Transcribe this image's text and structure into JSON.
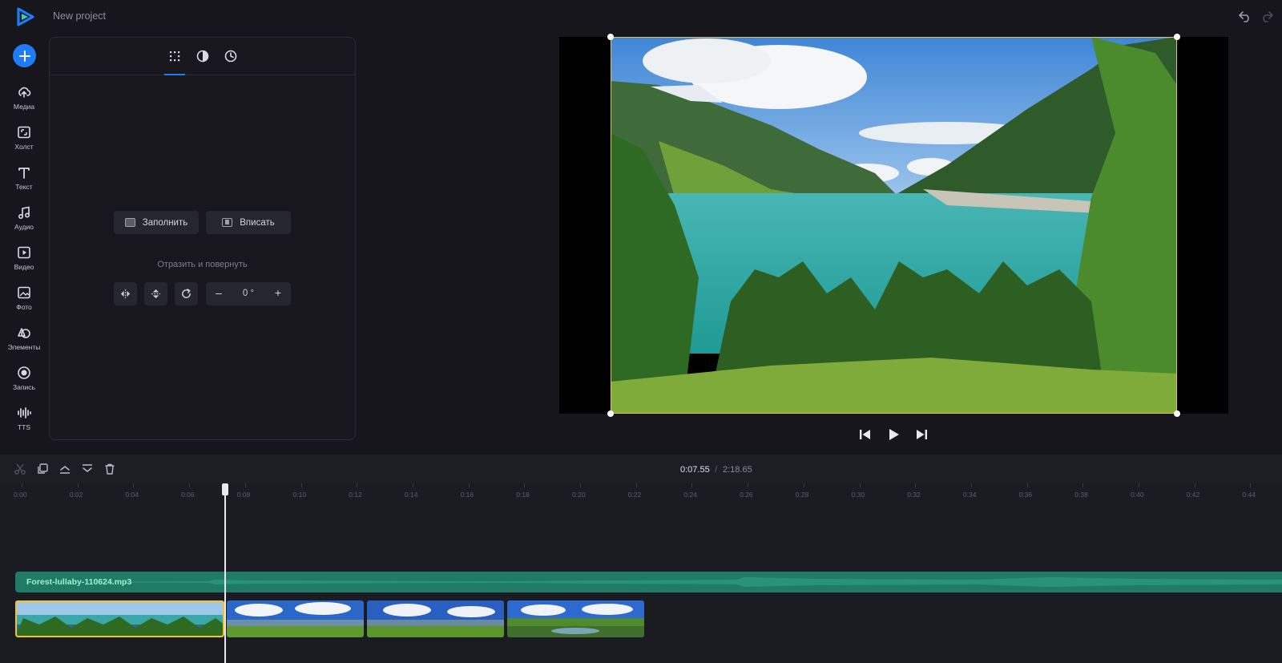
{
  "app": {
    "project_title": "New project",
    "accent_color": "#1e7cf7",
    "icons": [
      "logo-icon",
      "undo-icon",
      "redo-icon"
    ]
  },
  "nav": {
    "add_icon": "plus-icon",
    "items": [
      {
        "label": "Медиа",
        "icon": "upload-cloud-icon"
      },
      {
        "label": "Холст",
        "icon": "canvas-icon"
      },
      {
        "label": "Текст",
        "icon": "text-icon"
      },
      {
        "label": "Аудио",
        "icon": "music-icon"
      },
      {
        "label": "Видео",
        "icon": "video-icon"
      },
      {
        "label": "Фото",
        "icon": "photo-icon"
      },
      {
        "label": "Элементы",
        "icon": "shapes-icon"
      },
      {
        "label": "Запись",
        "icon": "record-icon"
      },
      {
        "label": "TTS",
        "icon": "waveform-icon"
      }
    ]
  },
  "panel": {
    "tabs": [
      "crop-tab-icon",
      "adjust-tab-icon",
      "speed-tab-icon"
    ],
    "fill_label": "Заполнить",
    "fit_label": "Вписать",
    "flip_heading": "Отразить и повернуть",
    "rotation_value": "0 °",
    "minus": "–",
    "plus": "+"
  },
  "player": {
    "controls": [
      "skip-back-icon",
      "play-icon",
      "skip-forward-icon"
    ]
  },
  "timeline": {
    "current_time": "0:07.55",
    "separator": "/",
    "total_time": "2:18.65",
    "tools": [
      "scissors-icon",
      "duplicate-icon",
      "move-up-icon",
      "move-down-icon",
      "trash-icon"
    ],
    "ticks": [
      "0:00",
      "0:02",
      "0:04",
      "0:06",
      "0:08",
      "0:10",
      "0:12",
      "0:14",
      "0:16",
      "0:18",
      "0:20",
      "0:22",
      "0:24",
      "0:26",
      "0:28",
      "0:30",
      "0:32",
      "0:34",
      "0:36",
      "0:38",
      "0:40",
      "0:42",
      "0:44"
    ],
    "audio_track": "Forest-lullaby-110624.mp3",
    "audio_color": "#1f7a66",
    "selected_clip_color": "#f2c425"
  }
}
